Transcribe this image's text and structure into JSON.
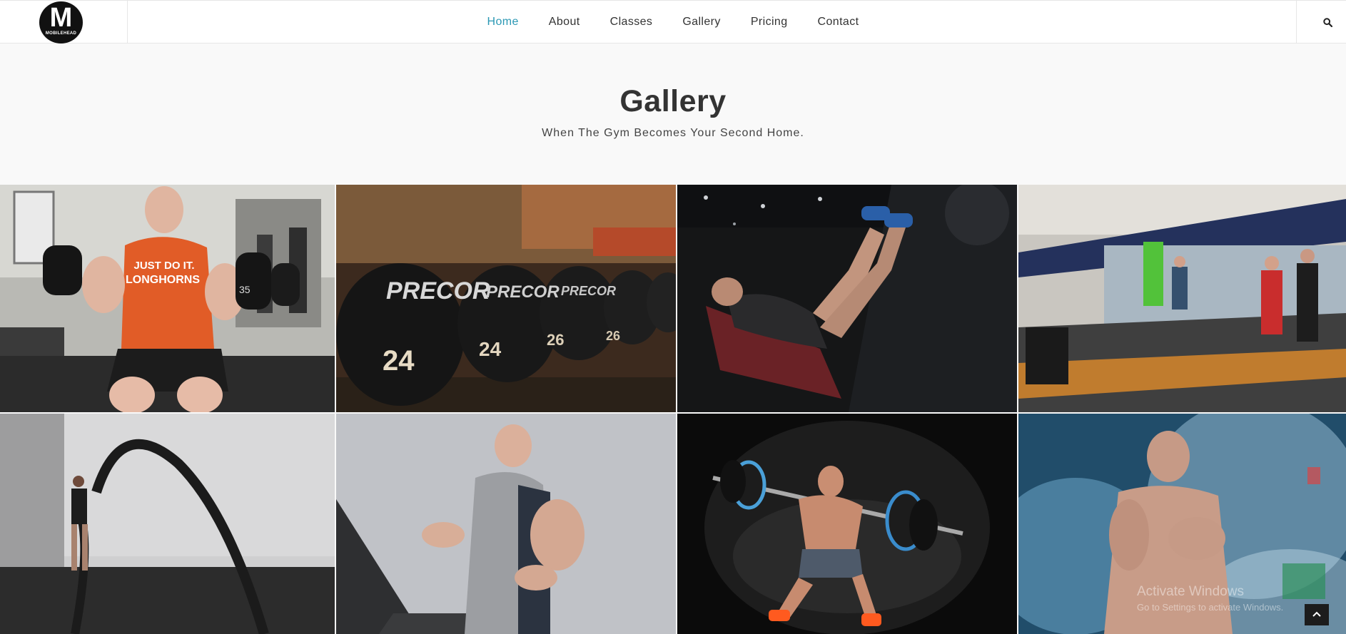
{
  "brand": {
    "letter": "M",
    "caption": "MOBILEHEAD"
  },
  "nav": {
    "items": [
      {
        "label": "Home",
        "active": true
      },
      {
        "label": "About",
        "active": false
      },
      {
        "label": "Classes",
        "active": false
      },
      {
        "label": "Gallery",
        "active": false
      },
      {
        "label": "Pricing",
        "active": false
      },
      {
        "label": "Contact",
        "active": false
      }
    ],
    "search_icon": "search-icon"
  },
  "header": {
    "title": "Gallery",
    "subtitle": "When The Gym Becomes Your Second Home."
  },
  "gallery": {
    "images": [
      {
        "name": "gallery-image-dumbbell-curl",
        "shirt_line1": "JUST DO IT.",
        "shirt_line2": "LONGHORNS",
        "weight": "35"
      },
      {
        "name": "gallery-image-precor-dumbbells",
        "brand": "PRECOR",
        "weights": [
          "24",
          "24",
          "26",
          "26"
        ]
      },
      {
        "name": "gallery-image-leg-press"
      },
      {
        "name": "gallery-image-treadmills"
      },
      {
        "name": "gallery-image-battle-ropes"
      },
      {
        "name": "gallery-image-treadmill-runner"
      },
      {
        "name": "gallery-image-barbell-squat"
      },
      {
        "name": "gallery-image-chalk-dust"
      }
    ]
  },
  "os_overlay": {
    "title": "Activate Windows",
    "subtitle": "Go to Settings to activate Windows."
  },
  "scroll_top_icon": "chevron-up-icon",
  "colors": {
    "accent": "#2b98b4",
    "text": "#333333",
    "background": "#f9f9f9"
  }
}
